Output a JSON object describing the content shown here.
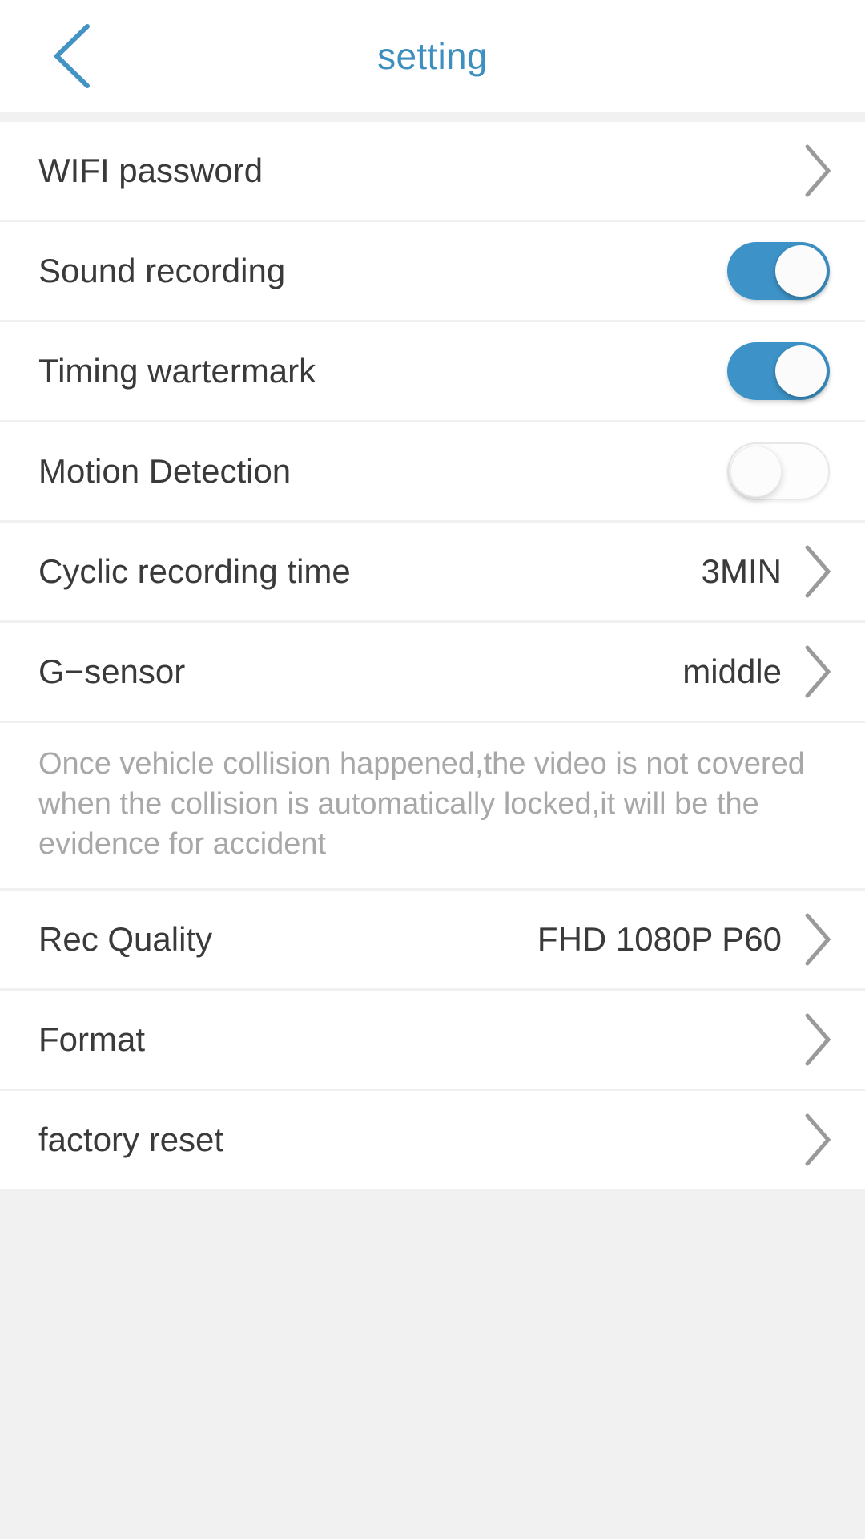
{
  "header": {
    "title": "setting",
    "back_icon": "chevron-left-icon",
    "accent_color": "#3d8fbf"
  },
  "colors": {
    "toggle_on": "#3d93c7",
    "toggle_off_track": "#fdfdfd",
    "label_text": "#3a3a3a",
    "description_text": "#a8a8a8",
    "chevron": "#9a9a9a",
    "page_background": "#f1f1f1",
    "row_background": "#ffffff"
  },
  "rows": [
    {
      "label": "WIFI password",
      "type": "navigation",
      "value": "",
      "chevron_icon": "chevron-right-icon",
      "name": "wifi-password"
    },
    {
      "label": "Sound recording",
      "type": "toggle",
      "toggle_state": "on",
      "name": "sound-recording"
    },
    {
      "label": "Timing wartermark",
      "type": "toggle",
      "toggle_state": "on",
      "name": "timing-watermark"
    },
    {
      "label": "Motion Detection",
      "type": "toggle",
      "toggle_state": "off",
      "name": "motion-detection"
    },
    {
      "label": "Cyclic recording time",
      "type": "navigation",
      "value": "3MIN",
      "chevron_icon": "chevron-right-icon",
      "name": "cyclic-recording-time"
    },
    {
      "label": "G−sensor",
      "type": "navigation",
      "value": "middle",
      "chevron_icon": "chevron-right-icon",
      "name": "g-sensor"
    }
  ],
  "description": "Once vehicle collision happened,the video is not covered when the collision is automatically locked,it will be the evidence for accident",
  "rows_bottom": [
    {
      "label": "Rec Quality",
      "type": "navigation",
      "value": "FHD 1080P P60",
      "chevron_icon": "chevron-right-icon",
      "name": "rec-quality"
    },
    {
      "label": "Format",
      "type": "navigation",
      "value": "",
      "chevron_icon": "chevron-right-icon",
      "name": "format"
    },
    {
      "label": "factory reset",
      "type": "navigation",
      "value": "",
      "chevron_icon": "chevron-right-icon",
      "name": "factory-reset"
    }
  ]
}
